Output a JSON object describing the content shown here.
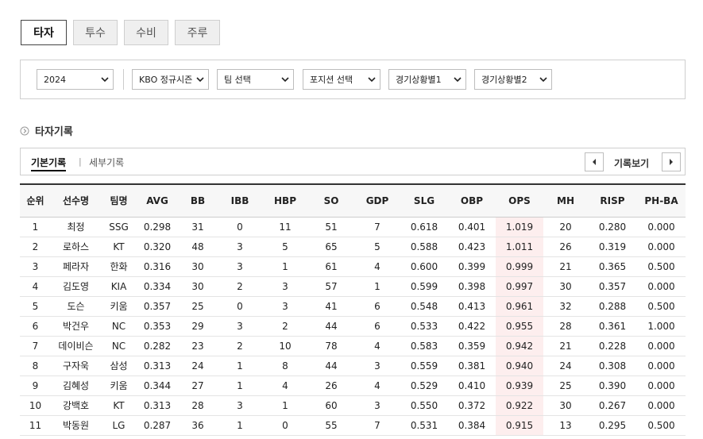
{
  "tabs": [
    "타자",
    "투수",
    "수비",
    "주루"
  ],
  "filters": {
    "year": "2024",
    "season": "KBO 정규시즌",
    "team": "팀 선택",
    "position": "포지션 선택",
    "situation1": "경기상황별1",
    "situation2": "경기상황별2"
  },
  "section": {
    "title": "타자기록"
  },
  "subtabs": {
    "basic": "기본기록",
    "separator": "|",
    "detail": "세부기록",
    "view": "기록보기"
  },
  "table": {
    "headers": [
      "순위",
      "선수명",
      "팀명",
      "AVG",
      "BB",
      "IBB",
      "HBP",
      "SO",
      "GDP",
      "SLG",
      "OBP",
      "OPS",
      "MH",
      "RISP",
      "PH-BA"
    ],
    "rows": [
      [
        "1",
        "최정",
        "SSG",
        "0.298",
        "31",
        "0",
        "11",
        "51",
        "7",
        "0.618",
        "0.401",
        "1.019",
        "20",
        "0.280",
        "0.000"
      ],
      [
        "2",
        "로하스",
        "KT",
        "0.320",
        "48",
        "3",
        "5",
        "65",
        "5",
        "0.588",
        "0.423",
        "1.011",
        "26",
        "0.319",
        "0.000"
      ],
      [
        "3",
        "페라자",
        "한화",
        "0.316",
        "30",
        "3",
        "1",
        "61",
        "4",
        "0.600",
        "0.399",
        "0.999",
        "21",
        "0.365",
        "0.500"
      ],
      [
        "4",
        "김도영",
        "KIA",
        "0.334",
        "30",
        "2",
        "3",
        "57",
        "1",
        "0.599",
        "0.398",
        "0.997",
        "30",
        "0.357",
        "0.000"
      ],
      [
        "5",
        "도슨",
        "키움",
        "0.357",
        "25",
        "0",
        "3",
        "41",
        "6",
        "0.548",
        "0.413",
        "0.961",
        "32",
        "0.288",
        "0.500"
      ],
      [
        "6",
        "박건우",
        "NC",
        "0.353",
        "29",
        "3",
        "2",
        "44",
        "6",
        "0.533",
        "0.422",
        "0.955",
        "28",
        "0.361",
        "1.000"
      ],
      [
        "7",
        "데이비슨",
        "NC",
        "0.282",
        "23",
        "2",
        "10",
        "78",
        "4",
        "0.583",
        "0.359",
        "0.942",
        "21",
        "0.228",
        "0.000"
      ],
      [
        "8",
        "구자욱",
        "삼성",
        "0.313",
        "24",
        "1",
        "8",
        "44",
        "3",
        "0.559",
        "0.381",
        "0.940",
        "24",
        "0.308",
        "0.000"
      ],
      [
        "9",
        "김혜성",
        "키움",
        "0.344",
        "27",
        "1",
        "4",
        "26",
        "4",
        "0.529",
        "0.410",
        "0.939",
        "25",
        "0.390",
        "0.000"
      ],
      [
        "10",
        "강백호",
        "KT",
        "0.313",
        "28",
        "3",
        "1",
        "60",
        "3",
        "0.550",
        "0.372",
        "0.922",
        "30",
        "0.267",
        "0.000"
      ],
      [
        "11",
        "박동원",
        "LG",
        "0.287",
        "36",
        "1",
        "0",
        "55",
        "7",
        "0.531",
        "0.384",
        "0.915",
        "13",
        "0.295",
        "0.500"
      ]
    ]
  }
}
